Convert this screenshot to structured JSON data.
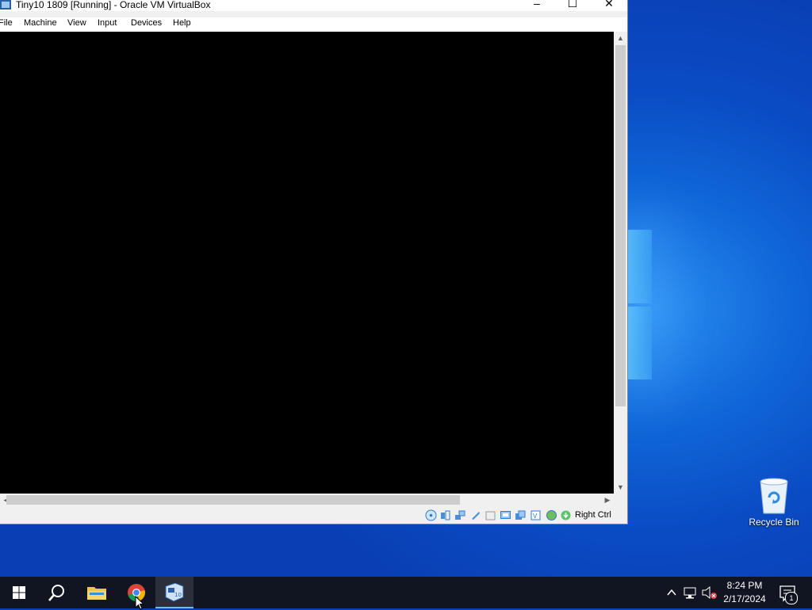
{
  "window": {
    "title": "Tiny10 1809 [Running] - Oracle VM VirtualBox",
    "controls": {
      "minimize": "–",
      "maximize": "☐",
      "close": "✕"
    }
  },
  "menu": [
    "File",
    "Machine",
    "View",
    "Input",
    "Devices",
    "Help"
  ],
  "status_bar": {
    "icons": [
      "optical-drive-icon",
      "audio-icon",
      "network-icon",
      "usb-icon",
      "shared-folders-icon",
      "display-icon",
      "video-capture-icon",
      "cpu-icon",
      "mouse-integration-icon",
      "host-key-icon"
    ],
    "host_key": "Right Ctrl"
  },
  "desktop": {
    "recycle_bin_label": "Recycle Bin"
  },
  "taskbar": {
    "apps": [
      "start-button",
      "search-button",
      "file-explorer",
      "chrome",
      "virtualbox"
    ],
    "active_app": "virtualbox",
    "clock_time": "8:24 PM",
    "clock_date": "2/17/2024",
    "notification_count": "1"
  },
  "colors": {
    "taskbar": "#101521",
    "desktop_accent": "#0a4bc4",
    "active_indicator": "#76b9ed"
  }
}
